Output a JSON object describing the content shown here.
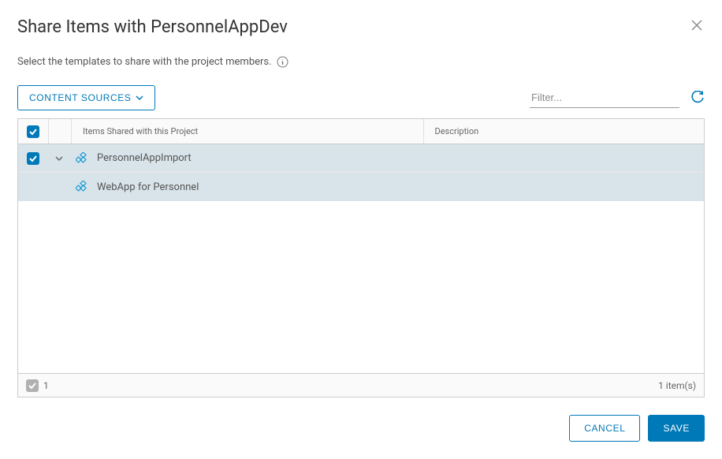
{
  "modal": {
    "title": "Share Items with PersonnelAppDev",
    "subtitle": "Select the templates to share with the project members."
  },
  "toolbar": {
    "content_sources_label": "CONTENT SOURCES",
    "filter_placeholder": "Filter..."
  },
  "table": {
    "columns": {
      "name": "Items Shared with this Project",
      "description": "Description"
    },
    "rows": [
      {
        "name": "PersonnelAppImport",
        "description": "",
        "checked": true,
        "expandable": true
      },
      {
        "name": "WebApp for Personnel",
        "description": "",
        "checked": false,
        "expandable": false
      }
    ]
  },
  "footer": {
    "selected_count": "1",
    "item_count_label": "1 item(s)"
  },
  "actions": {
    "cancel": "CANCEL",
    "save": "SAVE"
  }
}
